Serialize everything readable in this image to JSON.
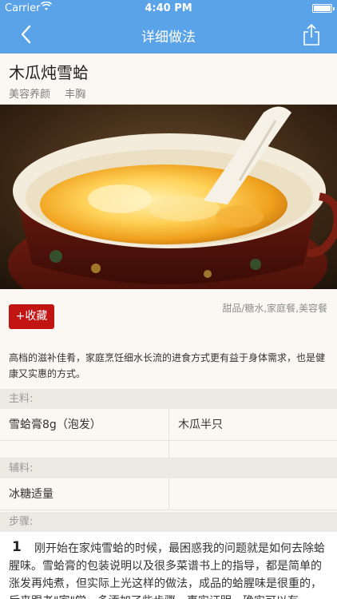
{
  "status_bar": {
    "carrier": "Carrier",
    "time": "4:40 PM"
  },
  "nav": {
    "title": "详细做法"
  },
  "recipe": {
    "title": "木瓜炖雪蛤",
    "tags": [
      "美容养颜",
      "丰胸"
    ],
    "favorite_label": "+收藏",
    "category": "甜品/糖水,家庭餐,美容餐",
    "description": "高档的滋补佳肴，家庭烹饪细水长流的进食方式更有益于身体需求，也是健康又实惠的方式。"
  },
  "main_ingredients": {
    "label": "主料:",
    "items": [
      "雪蛤膏8g（泡发）",
      "木瓜半只",
      "",
      ""
    ]
  },
  "secondary_ingredients": {
    "label": "辅料:",
    "items": [
      "冰糖适量",
      ""
    ]
  },
  "steps": {
    "label": "步骤:",
    "items": [
      {
        "number": "1",
        "text": "刚开始在家炖雪蛤的时候，最困惑我的问题就是如何去除蛤腥味。雪蛤膏的包装说明以及很多菜谱书上的指导，都是简单的涨发再炖煮，但实际上光这样的做法，成品的蛤腥味是很重的，后来跟老\"家\"学，多添加了些步骤，事实证明，确实可以有"
      }
    ]
  },
  "colors": {
    "nav_bg": "#5aa3e8",
    "favorite_btn": "#c31414",
    "section_bg": "#ece9e3"
  }
}
